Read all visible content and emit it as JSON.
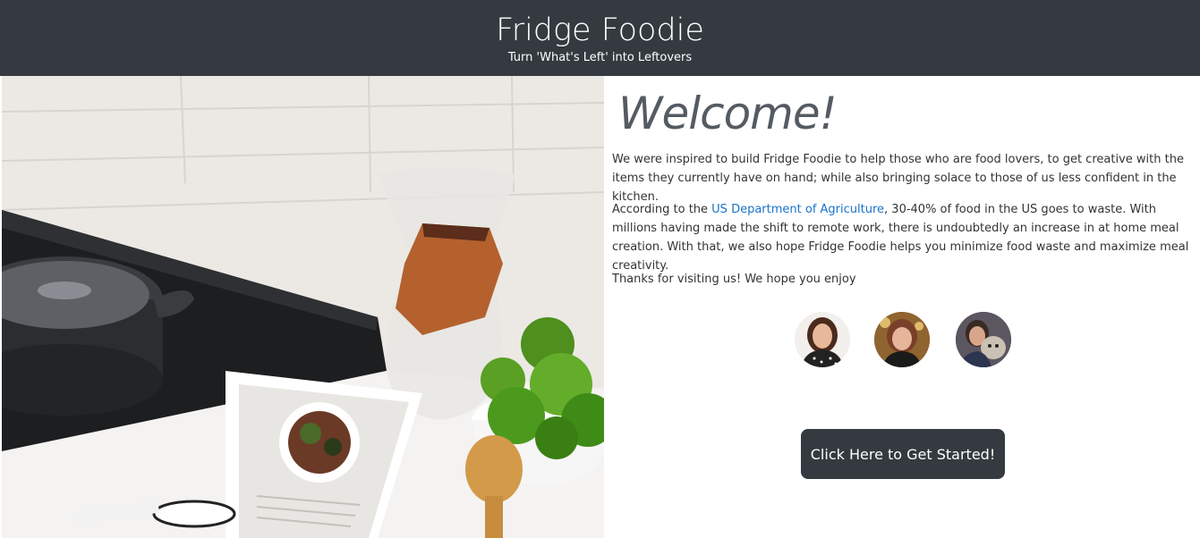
{
  "header": {
    "title": "Fridge Foodie",
    "tagline": "Turn 'What's Left' into Leftovers"
  },
  "hero": {
    "image": "kitchen-counter-tablet-recipe-limes-pour-over"
  },
  "main": {
    "heading": "Welcome!",
    "intro": "We were inspired to build Fridge Foodie to help those who are food lovers, to get creative with the items they currently have on hand; while also bringing solace to those of us less confident in the kitchen.",
    "stats_prefix": "According to the ",
    "stats_link": "US Department of Agriculture",
    "stats_suffix": ", 30-40% of food in the US goes to waste. With millions having made the shift to remote work, there is undoubtedly an increase in at home meal creation. With that, we also hope Fridge Foodie helps you minimize food waste and maximize meal creativity.",
    "thanks": "Thanks for visiting us! We hope you enjoy",
    "cta_label": "Click Here to Get Started!"
  },
  "team": [
    {
      "name": "team-member-1"
    },
    {
      "name": "team-member-2"
    },
    {
      "name": "team-member-3"
    }
  ],
  "colors": {
    "header_bg": "#343a40",
    "link": "#1a73c8",
    "button_bg": "#343a40"
  }
}
